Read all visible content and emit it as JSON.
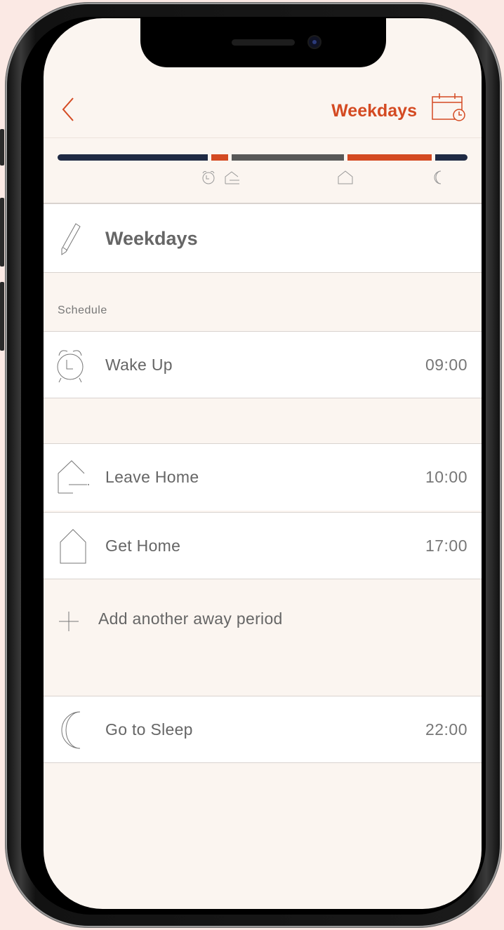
{
  "header": {
    "back_icon": "chevron-left-icon",
    "title": "Weekdays",
    "calendar_icon": "calendar-clock-icon",
    "accent_color": "#d44a22"
  },
  "timeline": {
    "colors": {
      "night": "#1f2a44",
      "active": "#d44a22",
      "away": "#585858"
    },
    "segments": [
      "night",
      "active",
      "away",
      "active",
      "night"
    ],
    "icons": [
      "alarm-clock-icon",
      "leave-home-icon",
      "home-icon",
      "moon-icon"
    ]
  },
  "name_row": {
    "icon": "pencil-icon",
    "label": "Weekdays"
  },
  "schedule": {
    "section_label": "Schedule",
    "wake_up": {
      "icon": "alarm-clock-icon",
      "label": "Wake Up",
      "time": "09:00"
    },
    "leave_home": {
      "icon": "leave-home-icon",
      "label": "Leave Home",
      "time": "10:00"
    },
    "get_home": {
      "icon": "home-icon",
      "label": "Get Home",
      "time": "17:00"
    },
    "add_away": {
      "icon": "plus-icon",
      "label": "Add another away period"
    },
    "sleep": {
      "icon": "moon-icon",
      "label": "Go to Sleep",
      "time": "22:00"
    }
  }
}
